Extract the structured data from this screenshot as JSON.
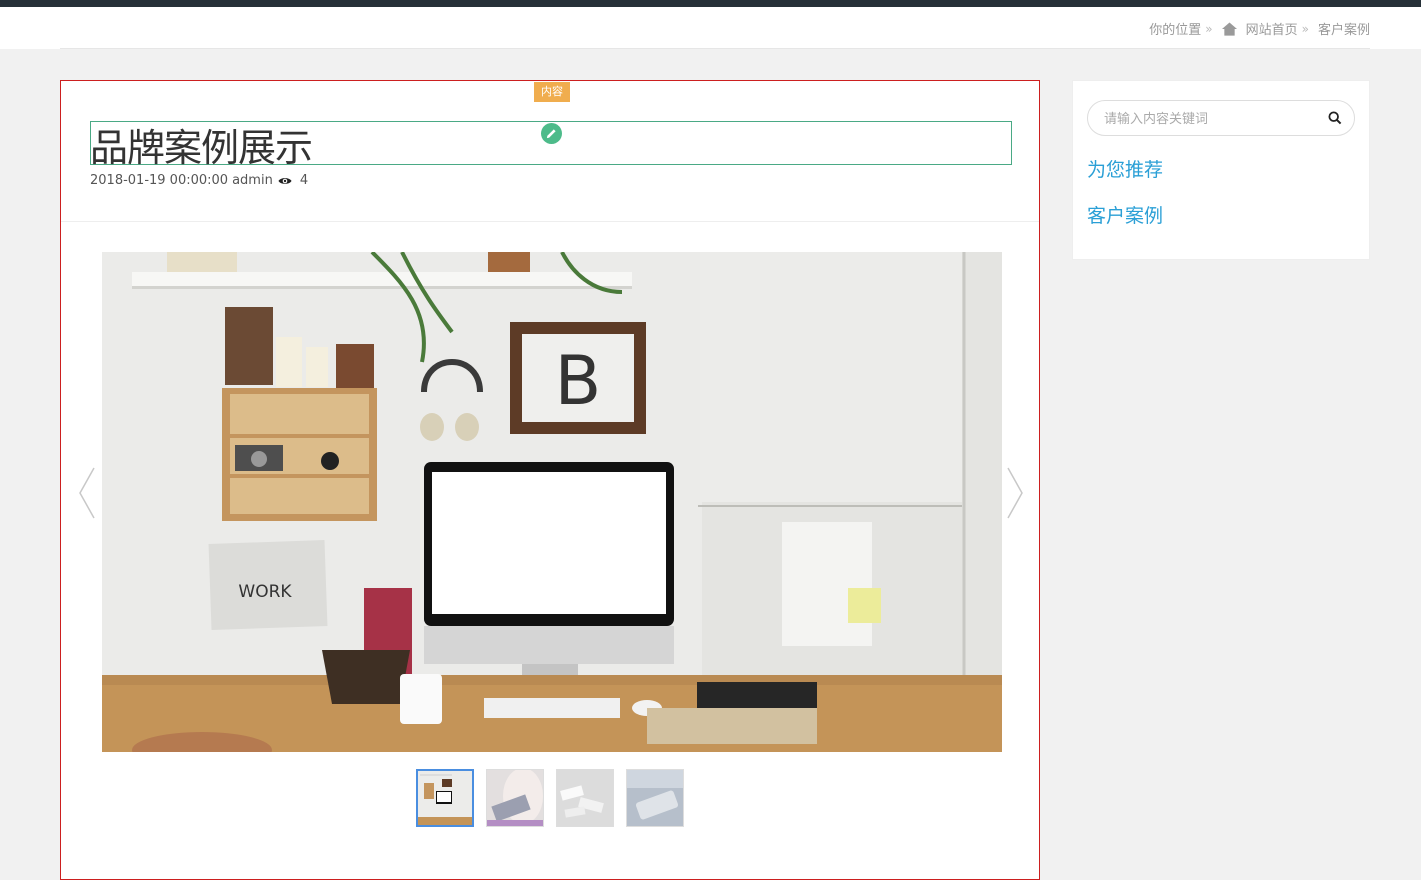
{
  "breadcrumb": {
    "prefix": "你的位置",
    "sep": "»",
    "home": "网站首页",
    "current": "客户案例"
  },
  "article": {
    "tag": "内容",
    "title": "品牌案例展示",
    "date": "2018-01-19 00:00:00",
    "author": "admin",
    "views": "4"
  },
  "slider": {
    "thumb_count": 4,
    "active_index": 0,
    "work_sign": "WORK",
    "frame_letter": "B"
  },
  "sidebar": {
    "search_placeholder": "请输入内容关键词",
    "links": [
      "为您推荐",
      "客户案例"
    ]
  },
  "colors": {
    "accent": "#2a9fd6",
    "tag": "#f0ad4e",
    "edit": "#4dbb8a",
    "topbar": "#263038",
    "outline": "#cc1f1f"
  }
}
